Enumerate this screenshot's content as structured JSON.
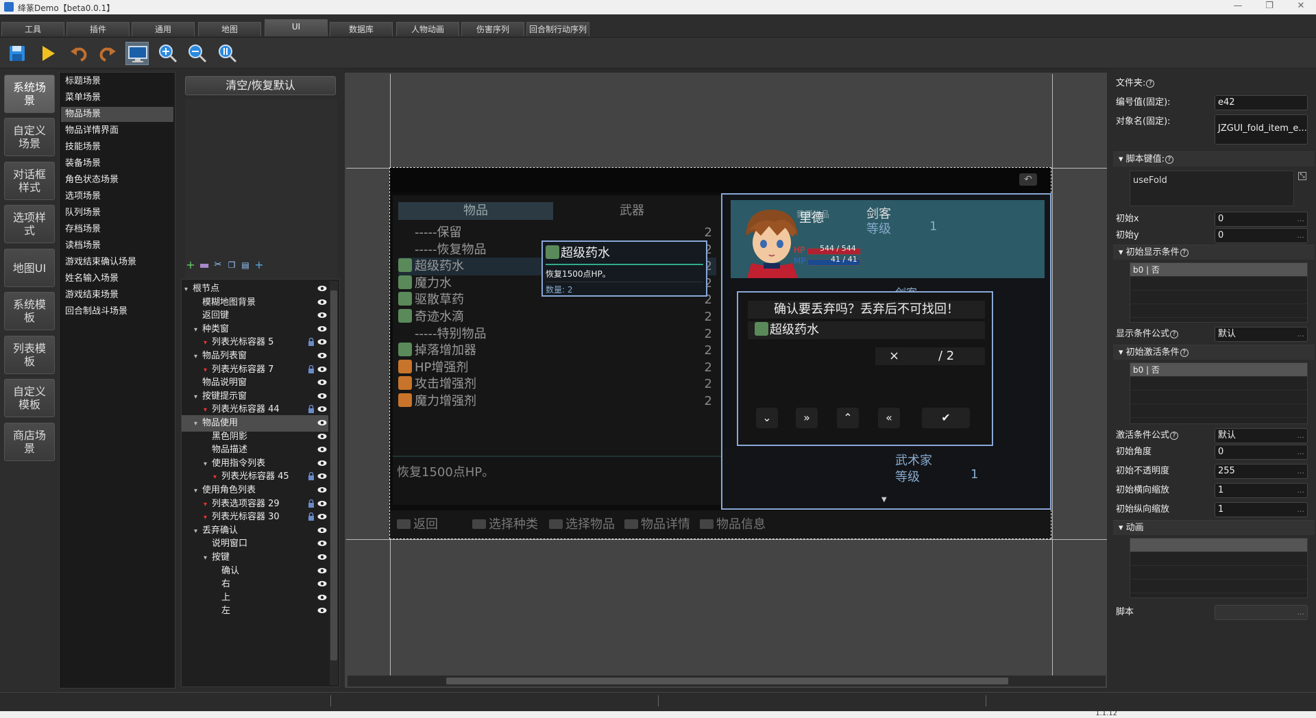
{
  "window": {
    "title": "绛篆Demo【beta0.0.1】",
    "min_glyph": "—",
    "max_glyph": "❐",
    "close_glyph": "✕"
  },
  "menu_tabs": [
    "工具",
    "插件",
    "通用",
    "地图",
    "UI",
    "数据库",
    "人物动画",
    "伤害序列",
    "回合制行动序列"
  ],
  "active_menu_tab": "UI",
  "toolbar": {
    "icons": [
      "save-icon",
      "play-icon",
      "undo-icon",
      "redo-icon",
      "monitor-icon",
      "zoom-in-icon",
      "zoom-out-icon",
      "zoom-reset-icon"
    ]
  },
  "left_nav": [
    {
      "label": "系统场景",
      "active": true
    },
    {
      "label": "自定义场景"
    },
    {
      "label": "对话框样式"
    },
    {
      "label": "选项样式"
    },
    {
      "label": "地图UI"
    },
    {
      "label": "系统模板"
    },
    {
      "label": "列表模板"
    },
    {
      "label": "自定义模板"
    },
    {
      "label": "商店场景"
    }
  ],
  "scene_list": [
    "标题场景",
    "菜单场景",
    "物品场景",
    "物品详情界面",
    "技能场景",
    "装备场景",
    "角色状态场景",
    "选项场景",
    "队列场景",
    "存档场景",
    "读档场景",
    "游戏结束确认场景",
    "姓名输入场景",
    "游戏结束场景",
    "回合制战斗场景"
  ],
  "active_scene": "物品场景",
  "mid": {
    "reset_label": "清空/恢复默认",
    "tree_tools": [
      "add-icon",
      "delete-icon",
      "cut-icon",
      "copy-icon",
      "paste-icon",
      "add-child-icon"
    ]
  },
  "tree": [
    {
      "label": "根节点",
      "indent": 0,
      "twisty": "▾"
    },
    {
      "label": "模糊地图背景",
      "indent": 1
    },
    {
      "label": "返回键",
      "indent": 1
    },
    {
      "label": "种类窗",
      "indent": 1,
      "twisty": "▾"
    },
    {
      "label": "列表光标容器 5",
      "indent": 2,
      "twisty": "▾",
      "red": true,
      "lock": true
    },
    {
      "label": "物品列表窗",
      "indent": 1,
      "twisty": "▾"
    },
    {
      "label": "列表光标容器 7",
      "indent": 2,
      "twisty": "▾",
      "red": true,
      "lock": true
    },
    {
      "label": "物品说明窗",
      "indent": 1
    },
    {
      "label": "按键提示窗",
      "indent": 1,
      "twisty": "▾"
    },
    {
      "label": "列表光标容器 44",
      "indent": 2,
      "twisty": "▾",
      "red": true,
      "lock": true
    },
    {
      "label": "物品使用",
      "indent": 1,
      "twisty": "▾",
      "active": true
    },
    {
      "label": "黑色阴影",
      "indent": 2
    },
    {
      "label": "物品描述",
      "indent": 2
    },
    {
      "label": "使用指令列表",
      "indent": 2,
      "twisty": "▾"
    },
    {
      "label": "列表光标容器 45",
      "indent": 3,
      "twisty": "▾",
      "red": true,
      "lock": true
    },
    {
      "label": "使用角色列表",
      "indent": 1,
      "twisty": "▾"
    },
    {
      "label": "列表选项容器 29",
      "indent": 2,
      "twisty": "▾",
      "red": true,
      "lock": true
    },
    {
      "label": "列表光标容器 30",
      "indent": 2,
      "twisty": "▾",
      "red": true,
      "lock": true
    },
    {
      "label": "丢弃确认",
      "indent": 1,
      "twisty": "▾"
    },
    {
      "label": "说明窗口",
      "indent": 2
    },
    {
      "label": "按键",
      "indent": 2,
      "twisty": "▾"
    },
    {
      "label": "确认",
      "indent": 3
    },
    {
      "label": "右",
      "indent": 3
    },
    {
      "label": "上",
      "indent": 3
    },
    {
      "label": "左",
      "indent": 3
    }
  ],
  "game": {
    "tabs": [
      "物品",
      "武器"
    ],
    "items": [
      {
        "name": "-----保留",
        "icon": "",
        "qty": "2"
      },
      {
        "name": "-----恢复物品",
        "icon": "",
        "qty": "2"
      },
      {
        "name": "超级药水",
        "icon": "potion",
        "qty": "2"
      },
      {
        "name": "魔力水",
        "icon": "potion",
        "qty": "2"
      },
      {
        "name": "驱散草药",
        "icon": "potion",
        "qty": "2"
      },
      {
        "name": "奇迹水滴",
        "icon": "potion",
        "qty": "2"
      },
      {
        "name": "-----特别物品",
        "icon": "",
        "qty": "2"
      },
      {
        "name": "掉落增加器",
        "icon": "potion",
        "qty": "2"
      },
      {
        "name": "HP增强剂",
        "icon": "orange",
        "qty": "2"
      },
      {
        "name": "攻击增强剂",
        "icon": "orange",
        "qty": "2"
      },
      {
        "name": "魔力增强剂",
        "icon": "orange",
        "qty": "2"
      }
    ],
    "description": "恢复1500点HP。",
    "hints": [
      "返回",
      "选择种类",
      "选择物品",
      "物品详情",
      "物品信息"
    ],
    "actor": {
      "name": "里德",
      "class": "剑客",
      "level_label": "等级",
      "level": "1",
      "hp_label": "HP",
      "hp": "544 / 544",
      "hp_fill": 1.0,
      "mp_label": "MP",
      "mp": "41 / 41",
      "mp_fill": 1.0,
      "faded_header": "需要物品"
    },
    "actor_rows": [
      {
        "class": "剑客"
      },
      {
        "class": "武术家",
        "level_label": "等级",
        "level": "1"
      },
      {
        "class": "武术家",
        "level_label": "等级",
        "level": "1"
      }
    ],
    "popup_item": {
      "name": "超级药水",
      "desc": "恢复1500点HP。",
      "count": "数量: 2"
    },
    "confirm": {
      "title": "确认要丢弃吗？丢弃后不可找回！",
      "item": "超级药水",
      "times": "×",
      "max": "/ 2",
      "buttons": [
        "chevron-down-icon",
        "double-chevron-down-icon",
        "chevron-up-icon",
        "double-chevron-up-icon",
        "check-icon"
      ]
    }
  },
  "props": {
    "folder_label": "文件夹:",
    "id_label": "编号值(固定):",
    "id_value": "e42",
    "objname_label": "对象名(固定):",
    "objname_value": "JZGUI_fold_item_e...",
    "script_key_section": "脚本键值:",
    "script_key_value": "useFold",
    "init_x_label": "初始x",
    "init_x": "0",
    "init_y_label": "初始y",
    "init_y": "0",
    "show_cond_section": "初始显示条件",
    "show_cond_row": "b0 | 否",
    "show_formula_label": "显示条件公式",
    "show_formula": "默认",
    "active_cond_section": "初始激活条件",
    "active_cond_row": "b0 | 否",
    "active_formula_label": "激活条件公式",
    "active_formula": "默认",
    "angle_label": "初始角度",
    "angle": "0",
    "opacity_label": "初始不透明度",
    "opacity": "255",
    "scalex_label": "初始横向缩放",
    "scalex": "1",
    "scaley_label": "初始纵向缩放",
    "scaley": "1",
    "anim_section": "动画",
    "script_label": "脚本",
    "dots": "...",
    "q": "?"
  },
  "status": {
    "version": "1.1.12"
  }
}
